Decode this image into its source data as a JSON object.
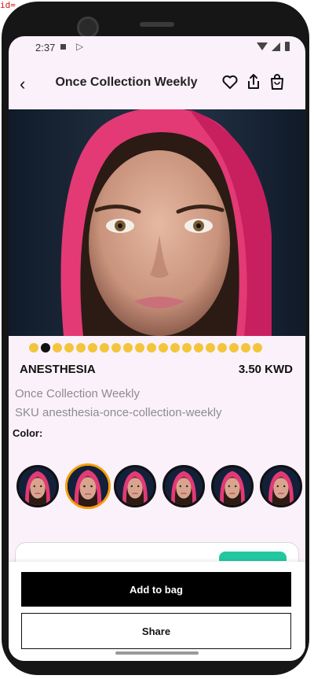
{
  "debug_text": "id=",
  "status_bar": {
    "time": "2:37",
    "icons": [
      "square-icon",
      "play-store-icon",
      "wifi-icon",
      "signal-icon",
      "battery-icon"
    ]
  },
  "header": {
    "title": "Once Collection Weekly",
    "icons": [
      "back-arrow-icon",
      "heart-icon",
      "share-icon",
      "shopping-bag-icon"
    ]
  },
  "carousel": {
    "total": 20,
    "active_index": 1
  },
  "product": {
    "name": "ANESTHESIA",
    "price": "3.50 KWD",
    "collection": "Once Collection Weekly",
    "sku": "SKU anesthesia-once-collection-weekly",
    "color_label": "Color:"
  },
  "swatches": {
    "count": 6,
    "selected_index": 1
  },
  "actions": {
    "add_to_bag": "Add to bag",
    "share": "Share"
  },
  "colors": {
    "accent_dot": "#f3c53b",
    "selected_swatch_border": "#f59e0b",
    "button_dark": "#000000",
    "background": "#fbf1fb",
    "pill_green": "#22c7a0"
  }
}
